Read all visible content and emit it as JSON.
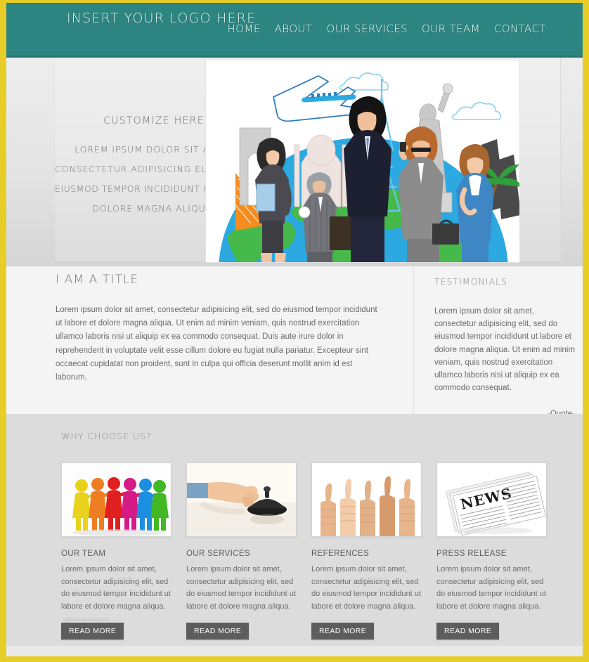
{
  "theme": {
    "border_yellow": "#e8cd28",
    "header_teal": "#2d8581",
    "page_bg": "#e9e9e9",
    "features_bg": "#dcdcdc",
    "button_gray": "#5d5d5d"
  },
  "header": {
    "logo": "INSERT YOUR LOGO HERE",
    "nav": [
      {
        "label": "HOME"
      },
      {
        "label": "ABOUT"
      },
      {
        "label": "OUR SERVICES"
      },
      {
        "label": "OUR TEAM"
      },
      {
        "label": "CONTACT"
      }
    ]
  },
  "hero": {
    "title": "CUSTOMIZE HERE",
    "lines": [
      "LOREM IPSUM DOLOR SIT AMET,",
      "CONSECTETUR ADIPISICING ELIT, SED DO",
      "EIUSMOD TEMPOR INCIDIDUNT UT LABORE ET",
      "DOLORE MAGNA ALIQUA."
    ],
    "image_alt": "business-people-globe-travel-illustration"
  },
  "content": {
    "title": "I AM A TITLE",
    "body": "Lorem ipsum dolor sit amet, consectetur adipisicing elit, sed do eiusmod tempor incididunt ut labore et dolore magna aliqua. Ut enim ad minim veniam, quis nostrud exercitation ullamco laboris nisi ut aliquip ex ea commodo consequat. Duis aute irure dolor in reprehenderit in voluptate velit esse cillum dolore eu fugiat nulla pariatur. Excepteur sint occaecat cupidatat non proident, sunt in culpa qui officia deserunt mollit anim id est laborum."
  },
  "testimonials": {
    "title": "TESTIMONIALS",
    "body": "Lorem ipsum dolor sit amet, consectetur adipisicing elit, sed do eiusmod tempor incididunt ut labore et dolore magna aliqua. Ut enim ad minim veniam, quis nostrud exercitation ullamco laboris nisi ut aliquip ex ea commodo consequat.",
    "attribution": "-Quote-"
  },
  "features": {
    "title": "WHY CHOOSE US?",
    "watermark": "aglassinastraw.com",
    "cards": [
      {
        "title": "OUR TEAM",
        "body": "Lorem ipsum dolor sit amet, consectetur adipisicing elit, sed do eiusmod tempor incididunt ut labore et dolore magna aliqua.",
        "button": "READ MORE",
        "image_alt": "colorful-3d-people-group"
      },
      {
        "title": "OUR SERVICES",
        "body": "Lorem ipsum dolor sit amet, consectetur adipisicing elit, sed do eiusmod tempor incididunt ut labore et dolore magna aliqua.",
        "button": "READ MORE",
        "image_alt": "hand-ringing-service-bell"
      },
      {
        "title": "REFERENCES",
        "body": "Lorem ipsum dolor sit amet, consectetur adipisicing elit, sed do eiusmod tempor incididunt ut labore et dolore magna aliqua.",
        "button": "READ MORE",
        "image_alt": "five-thumbs-up-hands"
      },
      {
        "title": "PRESS RELEASE",
        "body": "Lorem ipsum dolor sit amet, consectetur adipisicing elit, sed do eiusmod tempor incididunt ut labore et dolore magna aliqua.",
        "button": "READ MORE",
        "image_alt": "folded-news-newspaper"
      }
    ]
  }
}
